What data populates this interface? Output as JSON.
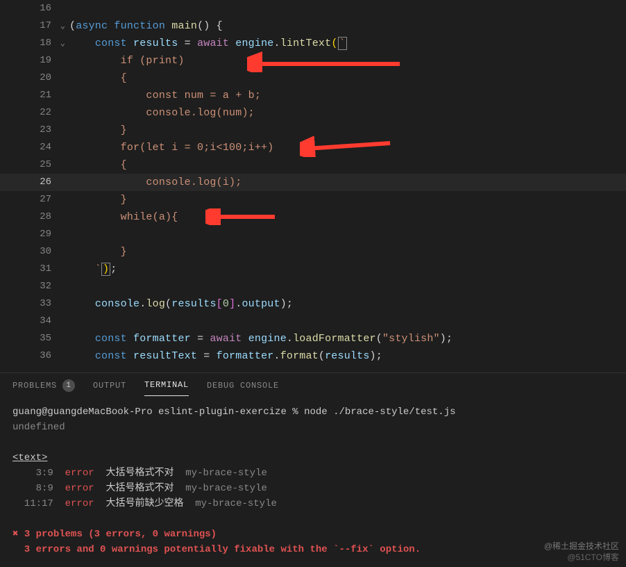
{
  "editor": {
    "lines": [
      {
        "num": "16",
        "html": ""
      },
      {
        "num": "17",
        "fold": true,
        "html": "<span class='tok-punc'>(</span><span class='tok-kw'>async</span> <span class='tok-kw'>function</span> <span class='tok-fn'>main</span><span class='tok-punc'>() {</span>"
      },
      {
        "num": "18",
        "fold": true,
        "html": "    <span class='tok-kw'>const</span> <span class='tok-var'>results</span> <span class='tok-punc'>=</span> <span class='tok-kw2'>await</span> <span class='tok-var'>engine</span><span class='tok-punc'>.</span><span class='tok-fn'>lintText</span><span class='tok-paren'>(</span><span class='tok-str cursor-box'>`</span>"
      },
      {
        "num": "19",
        "html": "<span class='tok-str'>        if (print)</span>"
      },
      {
        "num": "20",
        "html": "<span class='tok-str'>        {</span>"
      },
      {
        "num": "21",
        "html": "<span class='tok-str'>            const num = a + b;</span>"
      },
      {
        "num": "22",
        "html": "<span class='tok-str'>            console.log(num);</span>"
      },
      {
        "num": "23",
        "html": "<span class='tok-str'>        }</span>"
      },
      {
        "num": "24",
        "html": "<span class='tok-str'>        for(let i = 0;i&lt;100;i++)</span>"
      },
      {
        "num": "25",
        "html": "<span class='tok-str'>        {</span>"
      },
      {
        "num": "26",
        "current": true,
        "html": "<span class='tok-str'>            console.log(i);</span>"
      },
      {
        "num": "27",
        "html": "<span class='tok-str'>        }</span>"
      },
      {
        "num": "28",
        "html": "<span class='tok-str'>        while(a){</span>"
      },
      {
        "num": "29",
        "html": ""
      },
      {
        "num": "30",
        "html": "<span class='tok-str'>        }</span>"
      },
      {
        "num": "31",
        "html": "    <span class='tok-str'>`</span><span class='tok-paren cursor-box'>)</span><span class='tok-punc'>;</span>"
      },
      {
        "num": "32",
        "html": ""
      },
      {
        "num": "33",
        "html": "    <span class='tok-var'>console</span><span class='tok-punc'>.</span><span class='tok-fn'>log</span><span class='tok-punc'>(</span><span class='tok-var'>results</span><span class='tok-paren2'>[</span><span class='tok-num'>0</span><span class='tok-paren2'>]</span><span class='tok-punc'>.</span><span class='tok-var'>output</span><span class='tok-punc'>);</span>"
      },
      {
        "num": "34",
        "html": ""
      },
      {
        "num": "35",
        "html": "    <span class='tok-kw'>const</span> <span class='tok-var'>formatter</span> <span class='tok-punc'>=</span> <span class='tok-kw2'>await</span> <span class='tok-var'>engine</span><span class='tok-punc'>.</span><span class='tok-fn'>loadFormatter</span><span class='tok-punc'>(</span><span class='tok-str'>\"stylish\"</span><span class='tok-punc'>);</span>"
      },
      {
        "num": "36",
        "html": "    <span class='tok-kw'>const</span> <span class='tok-var'>resultText</span> <span class='tok-punc'>=</span> <span class='tok-var'>formatter</span><span class='tok-punc'>.</span><span class='tok-fn'>format</span><span class='tok-punc'>(</span><span class='tok-var'>results</span><span class='tok-punc'>);</span>"
      }
    ],
    "indentCol": 130
  },
  "panel": {
    "tabs": {
      "problems": "PROBLEMS",
      "problemsCount": "1",
      "output": "OUTPUT",
      "terminal": "TERMINAL",
      "debug": "DEBUG CONSOLE"
    },
    "terminal": {
      "prompt": "guang@guangdeMacBook-Pro eslint-plugin-exercize % node ./brace-style/test.js",
      "undefined": "undefined",
      "header": "<text>",
      "rows": [
        {
          "loc": "3:9",
          "sev": "error",
          "msg": "大括号格式不对",
          "rule": "my-brace-style"
        },
        {
          "loc": "8:9",
          "sev": "error",
          "msg": "大括号格式不对",
          "rule": "my-brace-style"
        },
        {
          "loc": "11:17",
          "sev": "error",
          "msg": "大括号前缺少空格",
          "rule": "my-brace-style"
        }
      ],
      "summary1": "✖ 3 problems (3 errors, 0 warnings)",
      "summary2": "  3 errors and 0 warnings potentially fixable with the `--fix` option."
    }
  },
  "watermark": {
    "l1": "@稀土掘金技术社区",
    "l2": "@51CTO博客"
  }
}
